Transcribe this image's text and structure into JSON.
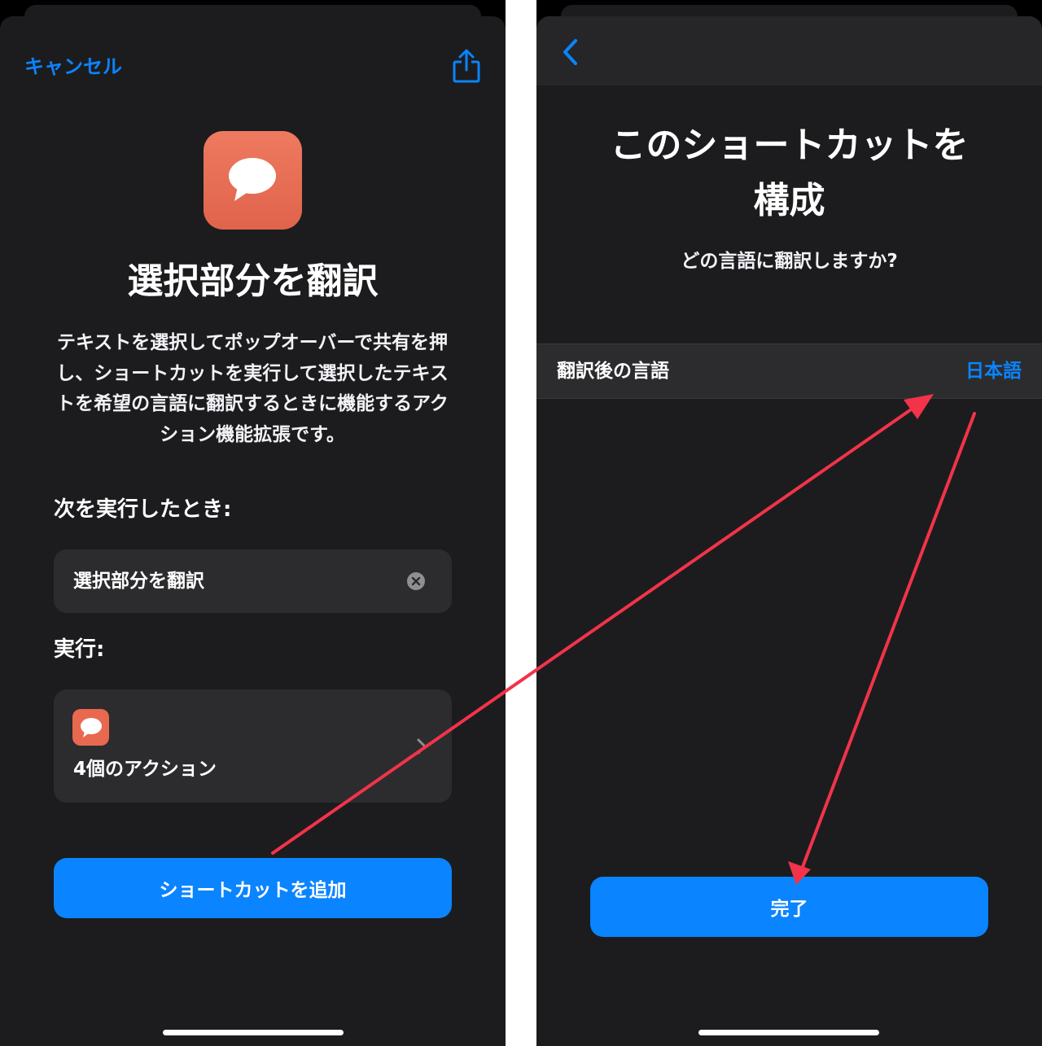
{
  "left_screen": {
    "nav": {
      "cancel_label": "キャンセル"
    },
    "shortcut": {
      "title": "選択部分を翻訳",
      "description": "テキストを選択してポップオーバーで共有を押し、ショートカットを実行して選択したテキストを希望の言語に翻訳するときに機能するアクション機能拡張です。"
    },
    "trigger": {
      "label": "次を実行したとき:",
      "value": "選択部分を翻訳"
    },
    "run": {
      "label": "実行:",
      "actions_count": "4個のアクション"
    },
    "add_button_label": "ショートカットを追加"
  },
  "right_screen": {
    "title_line1": "このショートカットを",
    "title_line2": "構成",
    "question": "どの言語に翻訳しますか?",
    "setting": {
      "label": "翻訳後の言語",
      "value": "日本語"
    },
    "done_button_label": "完了"
  },
  "colors": {
    "accent": "#0a84ff",
    "icon_orange": "#e8694f",
    "annotation_arrow": "#f2334a"
  }
}
